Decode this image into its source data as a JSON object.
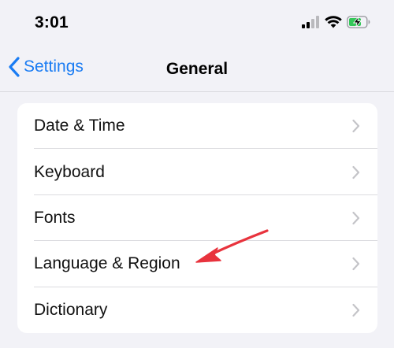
{
  "status_bar": {
    "time": "3:01"
  },
  "nav": {
    "back_label": "Settings",
    "title": "General"
  },
  "list": {
    "items": [
      {
        "label": "Date & Time"
      },
      {
        "label": "Keyboard"
      },
      {
        "label": "Fonts"
      },
      {
        "label": "Language & Region"
      },
      {
        "label": "Dictionary"
      }
    ]
  },
  "colors": {
    "accent": "#1a7cf3",
    "background": "#f2f2f7",
    "annotation": "#e8333d",
    "battery_charging": "#34c759"
  },
  "icons": {
    "cellular": "cellular-signal-icon",
    "wifi": "wifi-icon",
    "battery": "battery-charging-icon",
    "back": "chevron-left-icon",
    "disclosure": "chevron-right-icon"
  }
}
